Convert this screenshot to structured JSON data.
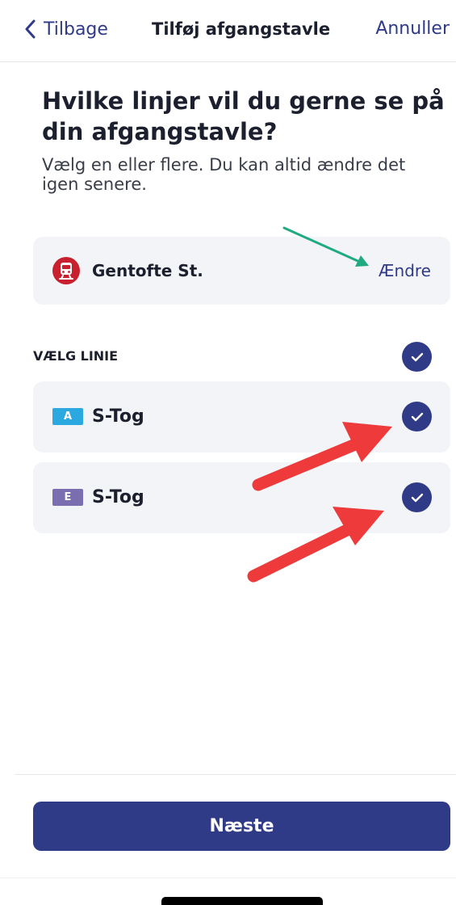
{
  "nav": {
    "back_label": "Tilbage",
    "title": "Tilføj afgangstavle",
    "cancel_label": "Annuller"
  },
  "heading": "Hvilke linjer vil du gerne se på din afgangstavle?",
  "subheading": "Vælg en eller flere. Du kan altid ændre det igen senere.",
  "station": {
    "name": "Gentofte St.",
    "change_label": "Ændre",
    "icon": "train-icon"
  },
  "section": {
    "label": "VÆLG LINIE",
    "select_all_checked": true
  },
  "lines": [
    {
      "badge": "A",
      "name": "S-Tog",
      "checked": true,
      "badge_color": "#2ba8e0"
    },
    {
      "badge": "E",
      "name": "S-Tog",
      "checked": true,
      "badge_color": "#7a6db0"
    }
  ],
  "footer": {
    "next_label": "Næste"
  },
  "colors": {
    "accent": "#2f3b86",
    "station_icon": "#c8202f",
    "annotation_red": "#ee3a3a",
    "annotation_green": "#1faa82"
  }
}
